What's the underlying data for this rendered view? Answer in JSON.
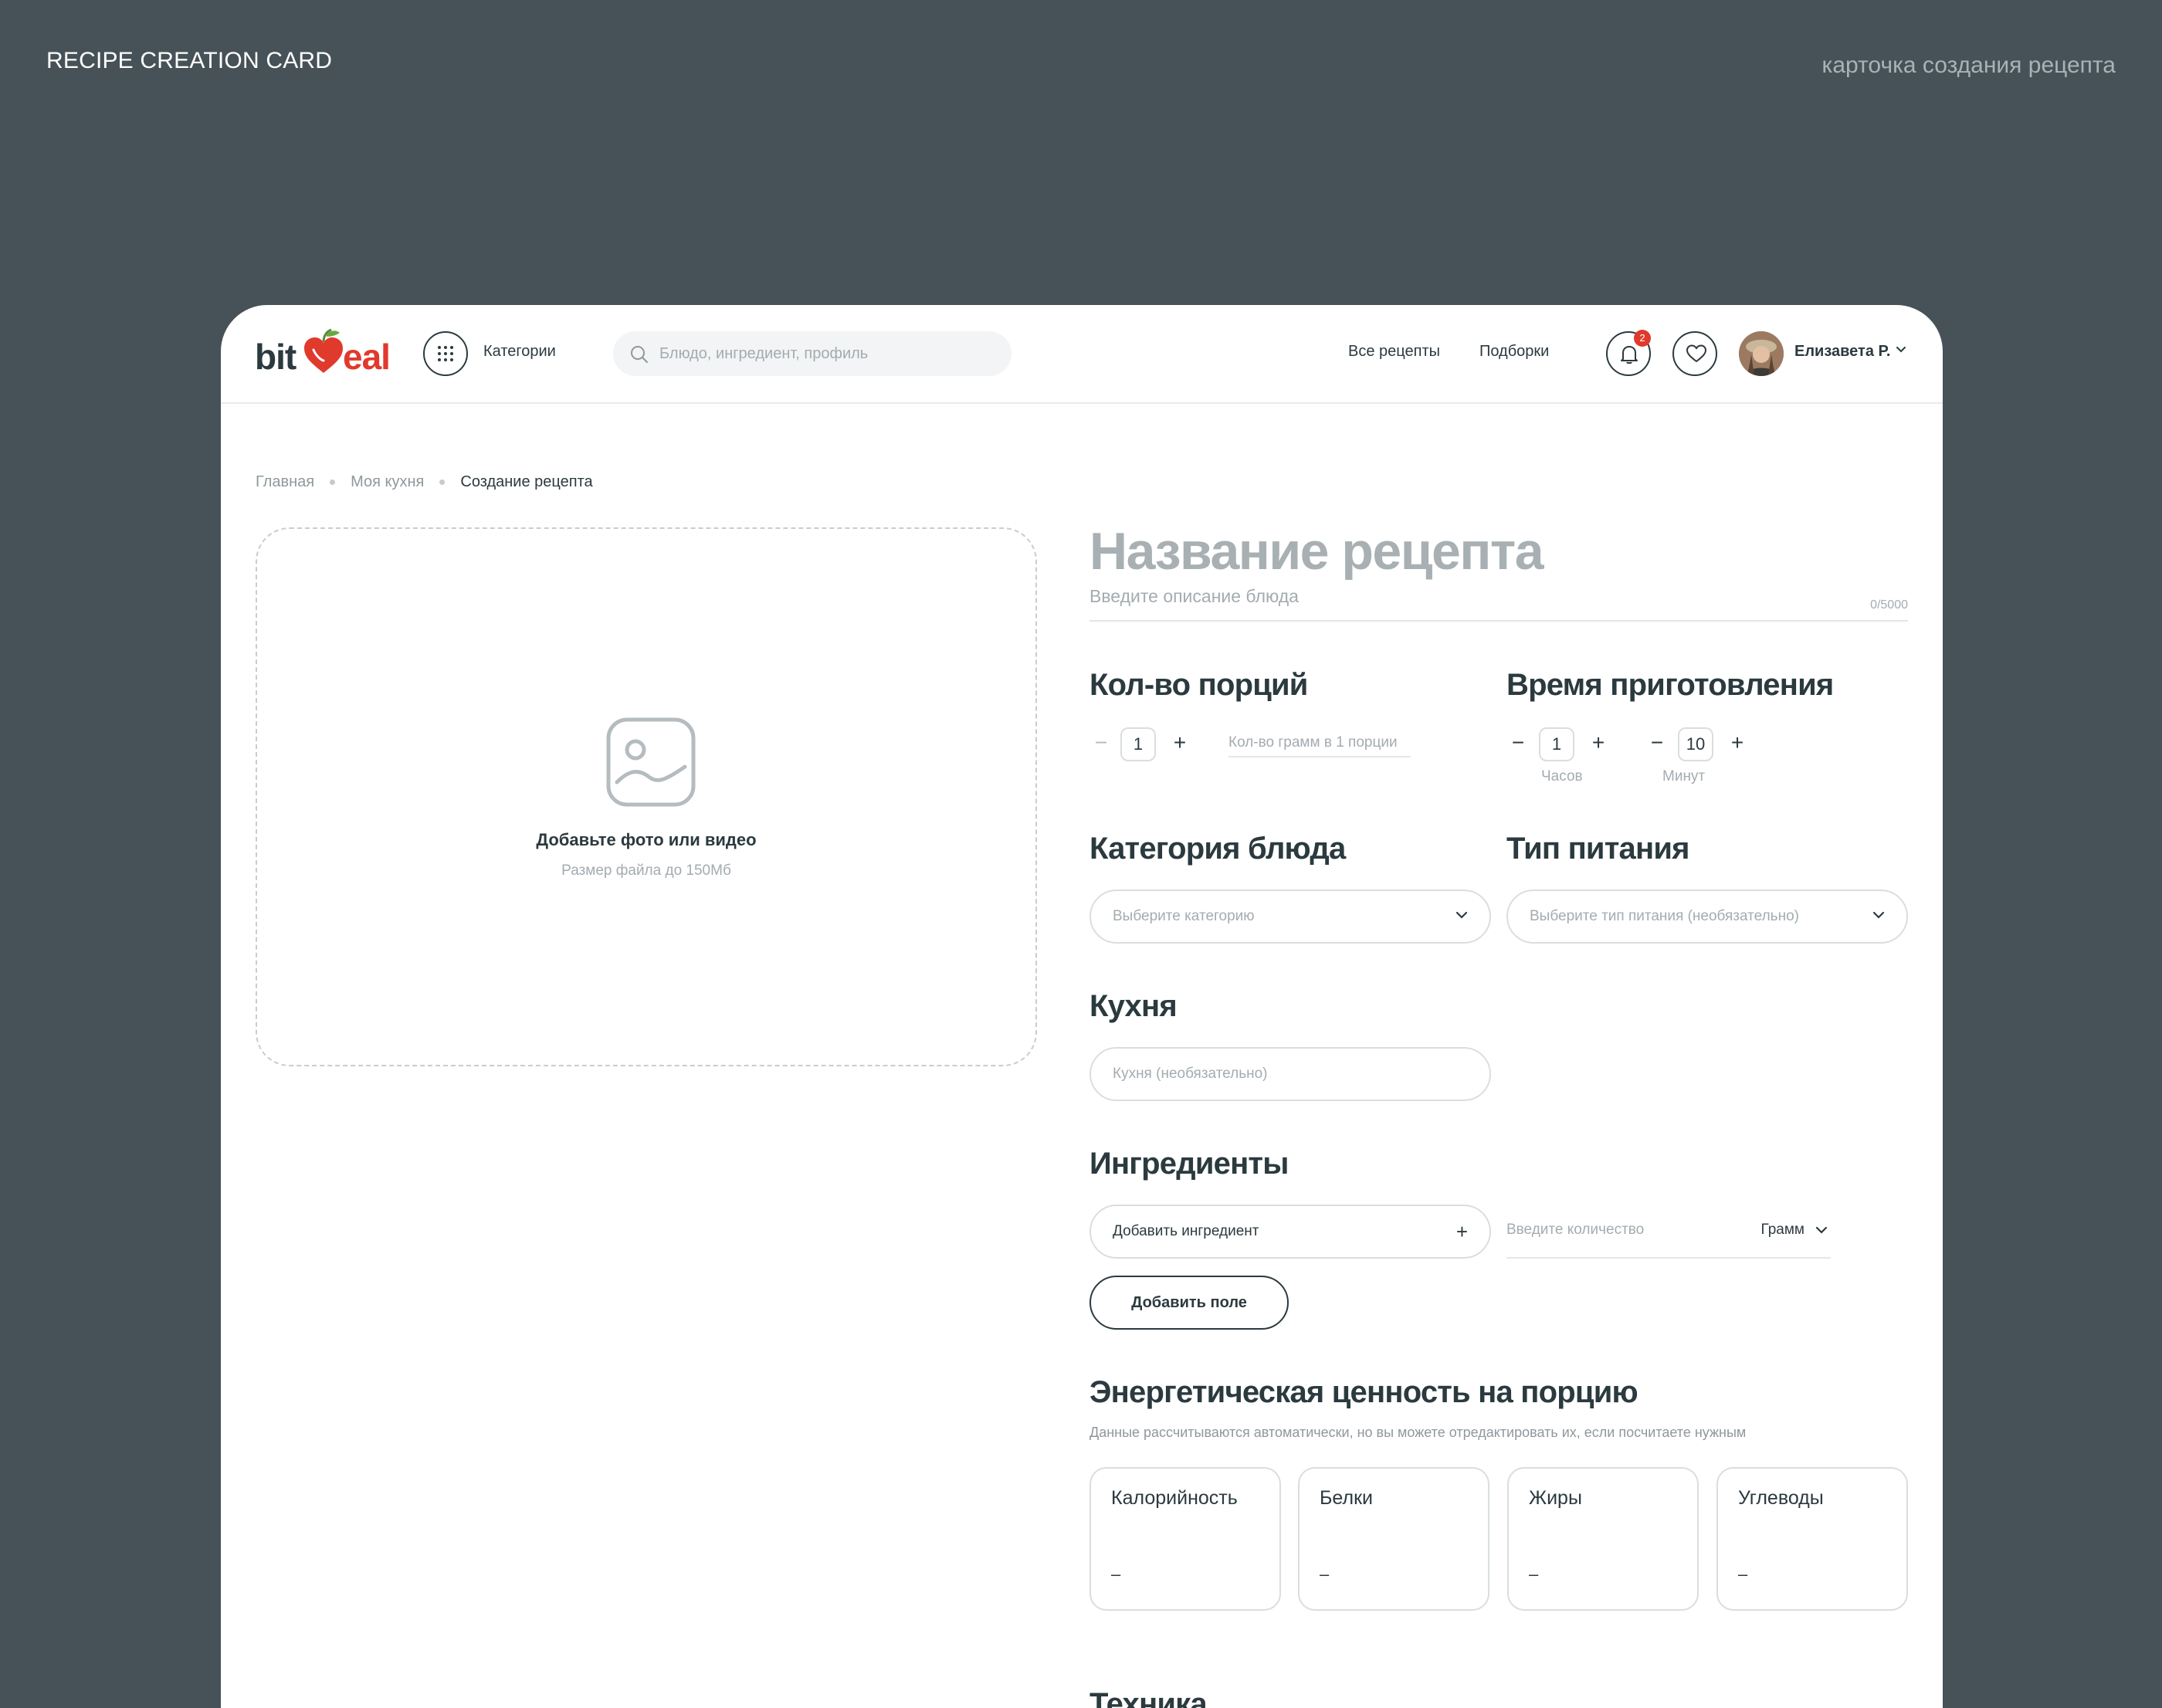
{
  "presentation": {
    "left_caption": "RECIPE CREATION CARD",
    "right_caption": "карточка создания рецепта"
  },
  "header": {
    "logo": {
      "part1": "bit",
      "part2": "eal",
      "icon": "heart-apple-icon"
    },
    "categories_label": "Категории",
    "search_placeholder": "Блюдо, ингредиент, профиль",
    "nav": {
      "all_recipes": "Все рецепты",
      "collections": "Подборки"
    },
    "notifications_count": "2",
    "user_name": "Елизавета Р."
  },
  "breadcrumb": [
    "Главная",
    "Моя кухня",
    "Создание рецепта"
  ],
  "upload": {
    "title": "Добавьте фото или видео",
    "subtitle": "Размер файла до 150Мб"
  },
  "form": {
    "title_placeholder": "Название рецепта",
    "description_placeholder": "Введите описание блюда",
    "description_counter": "0/5000",
    "servings": {
      "heading": "Кол-во порций",
      "value": "1",
      "grams_placeholder": "Кол-во грамм в 1 порции"
    },
    "cook_time": {
      "heading": "Время приготовления",
      "hours_value": "1",
      "hours_label": "Часов",
      "minutes_value": "10",
      "minutes_label": "Минут"
    },
    "dish_category": {
      "heading": "Категория блюда",
      "placeholder": "Выберите категорию"
    },
    "diet_type": {
      "heading": "Тип питания",
      "placeholder": "Выберите тип питания (необязательно)"
    },
    "cuisine": {
      "heading": "Кухня",
      "placeholder": "Кухня (необязательно)"
    },
    "ingredients": {
      "heading": "Ингредиенты",
      "add_label": "Добавить ингредиент",
      "qty_placeholder": "Введите количество",
      "unit": "Грамм",
      "add_field_label": "Добавить поле"
    },
    "energy": {
      "heading": "Энергетическая ценность на порцию",
      "note": "Данные рассчитываются автоматически, но вы можете отредактировать их, если посчитаете нужным",
      "cards": [
        {
          "label": "Калорийность",
          "value": "–"
        },
        {
          "label": "Белки",
          "value": "–"
        },
        {
          "label": "Жиры",
          "value": "–"
        },
        {
          "label": "Углеводы",
          "value": "–"
        }
      ]
    },
    "technique": {
      "heading": "Техника"
    }
  },
  "colors": {
    "page_bg": "#465258",
    "text_dark": "#2b3a3f",
    "accent_red": "#e03a2d",
    "placeholder": "#a3acb0",
    "border": "#d9dee0"
  }
}
